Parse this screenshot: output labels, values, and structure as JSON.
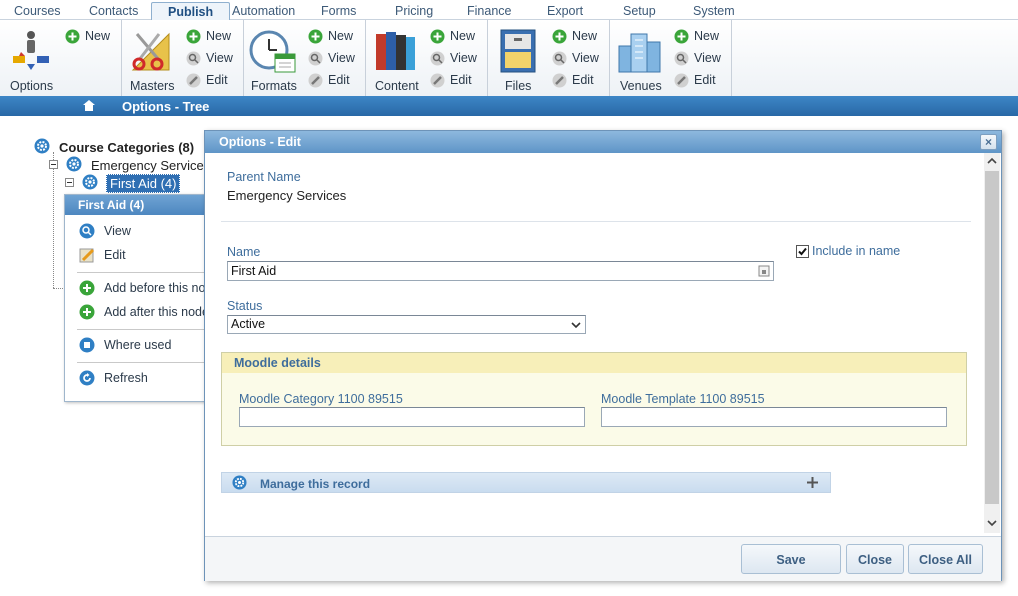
{
  "menu": {
    "tabs": [
      "Courses",
      "Contacts",
      "Publish",
      "Automation",
      "Forms",
      "Pricing",
      "Finance",
      "Export",
      "Setup",
      "System"
    ],
    "active": "Publish"
  },
  "ribbon": {
    "groups": [
      {
        "label": "Options",
        "new": "New"
      },
      {
        "label": "Masters",
        "new": "New",
        "view": "View",
        "edit": "Edit"
      },
      {
        "label": "Formats",
        "new": "New",
        "view": "View",
        "edit": "Edit"
      },
      {
        "label": "Content",
        "new": "New",
        "view": "View",
        "edit": "Edit"
      },
      {
        "label": "Files",
        "new": "New",
        "view": "View",
        "edit": "Edit"
      },
      {
        "label": "Venues",
        "new": "New",
        "view": "View",
        "edit": "Edit"
      }
    ]
  },
  "titlebar": {
    "title": "Options - Tree"
  },
  "tree": {
    "root": "Course Categories (8)",
    "child": "Emergency Service",
    "selected": "First Aid (4)"
  },
  "context_menu": {
    "title": "First Aid (4)",
    "items": [
      "View",
      "Edit",
      "Add before this no",
      "Add after this node",
      "Where used",
      "Refresh"
    ]
  },
  "dialog": {
    "title": "Options - Edit",
    "close_glyph": "×",
    "parent_name_label": "Parent Name",
    "parent_name_value": "Emergency Services",
    "name_label": "Name",
    "name_value": "First Aid",
    "include_in_name_label": "Include in name",
    "include_in_name_checked": true,
    "status_label": "Status",
    "status_value": "Active",
    "moodle": {
      "title": "Moodle details",
      "category_label": "Moodle Category 1100 89515",
      "category_value": "",
      "template_label": "Moodle Template 1100 89515",
      "template_value": ""
    },
    "manage_label": "Manage this record",
    "buttons": {
      "save": "Save",
      "close": "Close",
      "close_all": "Close All"
    }
  },
  "colors": {
    "accent_blue": "#2868a6",
    "label_blue": "#3e6d9c",
    "moodle_bg": "#fbfbe8",
    "icon_green": "#3aa53a"
  }
}
